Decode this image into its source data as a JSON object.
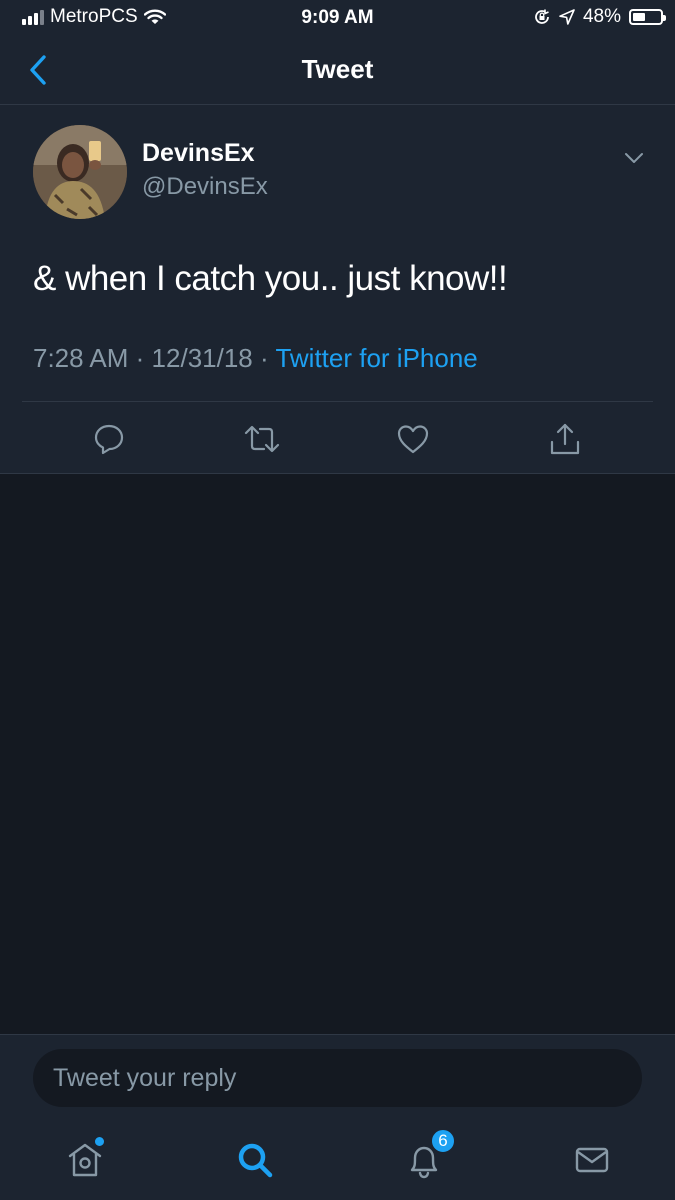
{
  "status_bar": {
    "carrier": "MetroPCS",
    "time": "9:09 AM",
    "battery": "48%",
    "battery_level": 0.48
  },
  "header": {
    "title": "Tweet",
    "back_icon": "chevron-left-icon"
  },
  "tweet": {
    "display_name": "DevinsEx",
    "handle": "@DevinsEx",
    "text": "& when I catch you.. just know!!",
    "time": "7:28 AM",
    "separator": "·",
    "date": "12/31/18",
    "source": "Twitter for iPhone",
    "actions": [
      "reply-icon",
      "retweet-icon",
      "like-icon",
      "share-icon"
    ]
  },
  "reply": {
    "placeholder": "Tweet your reply"
  },
  "tab_bar": {
    "items": [
      "home-icon",
      "search-icon",
      "notifications-icon",
      "messages-icon"
    ],
    "notifications_badge": "6"
  },
  "colors": {
    "background": "#141921",
    "surface": "#1c2430",
    "accent": "#1da1f2",
    "secondary_text": "#8899a6"
  }
}
